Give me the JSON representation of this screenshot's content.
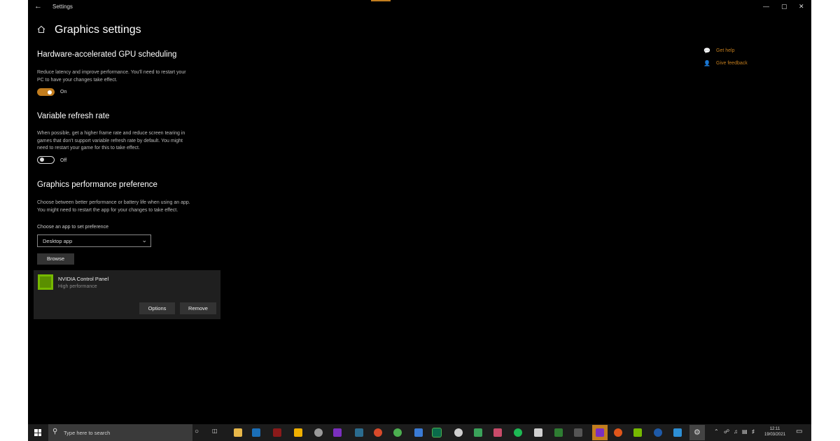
{
  "colors": {
    "accent": "#c27d1e",
    "background": "#000000",
    "card": "#1f1f1f",
    "taskbar": "#1c1c1c"
  },
  "window": {
    "title": "Settings",
    "back_icon": "back-arrow-icon",
    "minimize": "—",
    "maximize": "▢",
    "close": "✕"
  },
  "page": {
    "title": "Graphics settings",
    "icon": "home-icon"
  },
  "gpu_scheduling": {
    "heading": "Hardware-accelerated GPU scheduling",
    "desc_1": "Reduce latency and improve performance. You'll need to restart your",
    "desc_2": "PC to have your changes take effect.",
    "state": "On"
  },
  "vrr": {
    "heading": "Variable refresh rate",
    "desc_1": "When possible, get a higher frame rate and reduce screen tearing in",
    "desc_2": "games that don't support variable refresh rate by default. You might",
    "desc_3": "need to restart your game for this to take effect.",
    "state": "Off"
  },
  "preference": {
    "heading": "Graphics performance preference",
    "desc_1": "Choose between better performance or battery life when using an app.",
    "desc_2": "You might need to restart the app for your changes to take effect.",
    "select_label": "Choose an app to set preference",
    "select_value": "Desktop app",
    "browse_label": "Browse"
  },
  "app_entry": {
    "name": "NVIDIA Control Panel",
    "performance": "High performance",
    "options_label": "Options",
    "remove_label": "Remove"
  },
  "side_links": {
    "get_help": "Get help",
    "give_feedback": "Give feedback"
  },
  "taskbar": {
    "search_placeholder": "Type here to search",
    "time": "12:11",
    "date": "19/03/2021"
  }
}
